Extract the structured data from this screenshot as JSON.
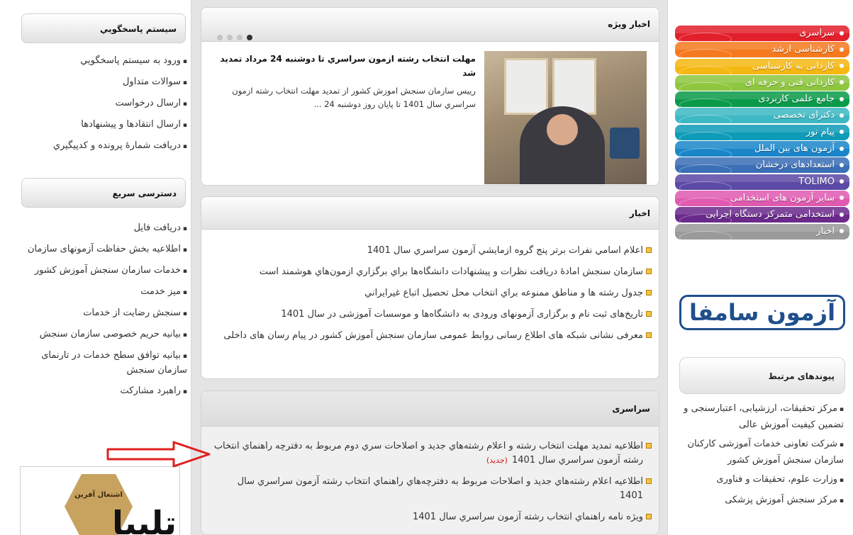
{
  "right_menu": {
    "items": [
      {
        "label": "سراسری",
        "color": "#e2202c"
      },
      {
        "label": "کارشناسی ارشد",
        "color": "#f57a1f"
      },
      {
        "label": "کاردانی به کارشناسی",
        "color": "#f5b712"
      },
      {
        "label": "کاردانی فنی و حرفه ای",
        "color": "#8ec63f"
      },
      {
        "label": "جامع علمی کاربردی",
        "color": "#0b9a4a"
      },
      {
        "label": "دکترای تخصصی",
        "color": "#3db8c4"
      },
      {
        "label": "پیام نور",
        "color": "#0e9bb8"
      },
      {
        "label": "آزمون های بین الملل",
        "color": "#1a86c9"
      },
      {
        "label": "استعدادهای درخشان",
        "color": "#3b6fb6"
      },
      {
        "label": "TOLIMO",
        "color": "#5b4aa6"
      },
      {
        "label": "سایر آزمون های استخدامی",
        "color": "#e05ab0"
      },
      {
        "label": "استخدامی متمرکز دستگاه اجرایی",
        "color": "#6a2a8c"
      },
      {
        "label": "اخبار",
        "color": "#9a9a9a"
      }
    ],
    "logo_text": "آزمون سامفا"
  },
  "related_links": {
    "title": "پیوندهای مرتبط",
    "items": [
      "مرکز تحقیقات، ارزشیابی، اعتبارسنجی و تضمین کیفیت آموزش عالی",
      "شرکت تعاونی خدمات آموزشی کارکنان سازمان سنجش آموزش کشور",
      "وزارت علوم، تحقیقات و فناوری",
      "مرکز سنجش آموزش پزشکی"
    ]
  },
  "featured": {
    "title": "اخبار ویژه",
    "headline": "مهلت انتخاب رشته ازمون سراسري تا دوشنبه 24 مرداد تمديد شد",
    "summary": "رييس سازمان سنجش اموزش کشور از تمديد مهلت انتخاب رشته ازمون سراسري سال 1401 تا پايان روز دوشنبه 24 ..."
  },
  "news": {
    "title": "اخبار",
    "items": [
      "اعلام اسامي نفرات برتر پنج گروه ازمايشي آزمون سراسري سال 1401",
      "سازمان سنجش امادۀ دريافت نظرات و پيشنهادات دانشگاه‌ها براي برگزاري ازمون‌هاي هوشمند است",
      "جدول رشته ها و مناطق ممنوعه براي انتخاب محل تحصيل اتباع غيرايراني",
      "تاریخ‌های ثبت نام و برگزاری آزمونهای ورودی به دانشگاه‌ها و موسسات آموزشی در سال 1401",
      "معرفی نشانی شبکه های اطلاع رسانی روابط عمومی سازمان سنجش آموزش کشور در پیام رسان های داخلی"
    ]
  },
  "sarasari": {
    "title": "سراسری",
    "new_label": "(جديد)",
    "items": [
      "اطلاعيه تمديد مهلت انتخاب رشته و اعلام رشته‌هاي جديد و اصلاحات سري دوم مربوط به دفترچه راهنماي انتخاب رشته آزمون سراسري سال 1401",
      "اطلاعيه اعلام رشته‌هاي جديد و اصلاحات مربوط به دفترچه‌هاي راهنماي انتخاب رشته آزمون سراسري سال 1401",
      "ويژه نامه راهنماي انتخاب رشته آزمون سراسري سال 1401"
    ]
  },
  "response_system": {
    "title": "سيستم پاسخگويي",
    "items": [
      "ورود به سيستم پاسخگويي",
      "سوالات متداول",
      "ارسال درخواست",
      "ارسال انتقادها و پيشنهادها",
      "دريافت شمارۀ پرونده و كدپيگيري"
    ]
  },
  "quick_access": {
    "title": "دسترسی سریع",
    "items": [
      "دریافت فایل",
      "اطلاعیه بخش حفاظت آزمونهای سازمان",
      "خدمات سازمان سنجش آموزش کشور",
      "میز خدمت",
      "سنجش رضایت از خدمات",
      "بیانیه حریم خصوصی سازمان سنجش",
      "بیانیه توافق سطح خدمات در تارنمای سازمان سنجش",
      "راهبرد مشارکت"
    ]
  },
  "ad": {
    "seal_text": "اشتغال آفرین",
    "big_text": "تلبیا"
  }
}
